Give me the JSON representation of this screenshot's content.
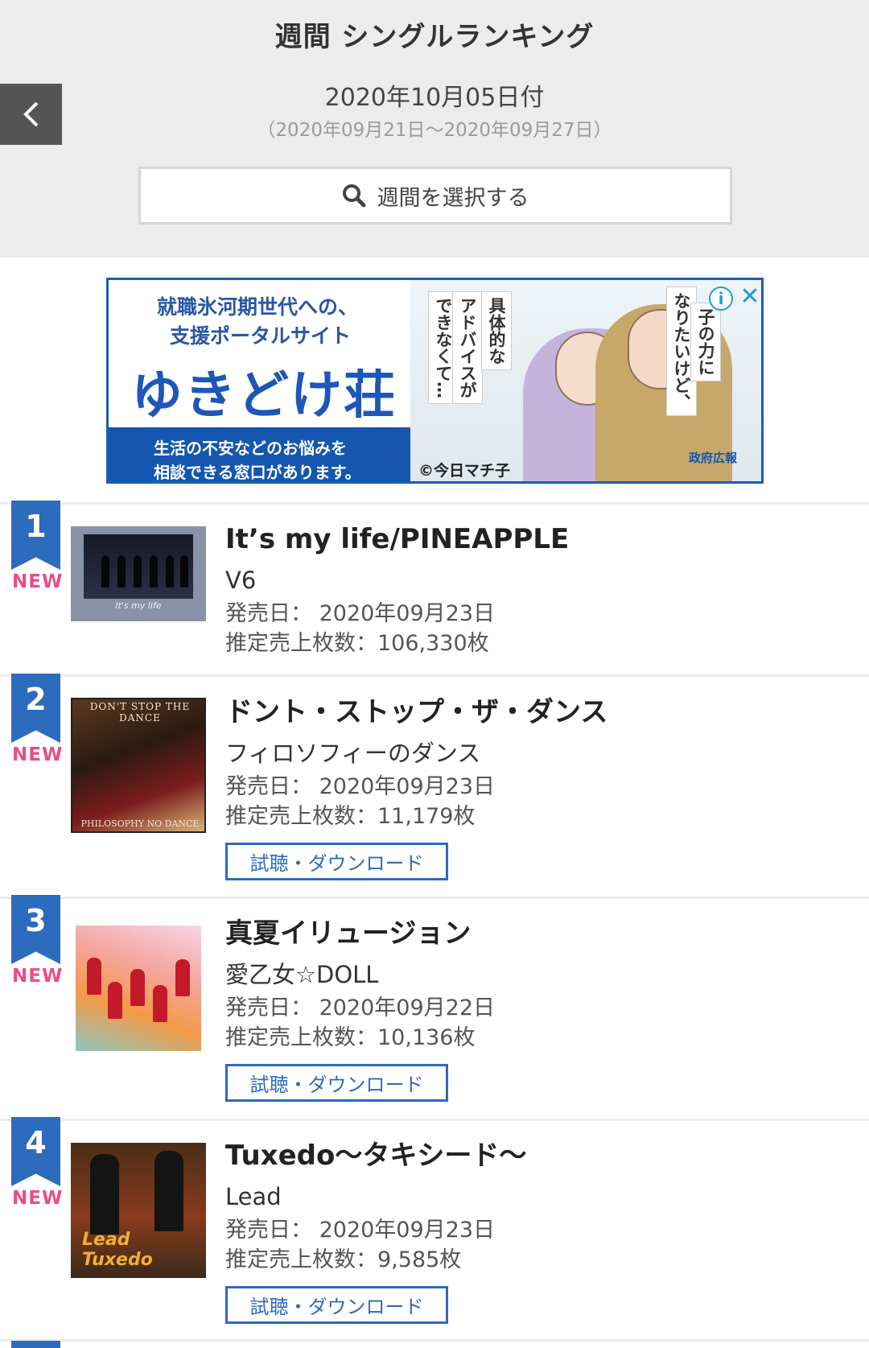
{
  "header": {
    "title": "週間 シングルランキング",
    "date": "2020年10月05日付",
    "range": "（2020年09月21日〜2020年09月27日）",
    "select_week_label": "週間を選択する"
  },
  "ad": {
    "line1": "就職氷河期世代への、",
    "line2": "支援ポータルサイト",
    "brand": "ゆきどけ荘",
    "bar_line1": "生活の不安などのお悩みを",
    "bar_line2": "相談できる窓口があります。",
    "bubble_a": "できなくて…",
    "bubble_b": "アドバイスが",
    "bubble_c": "具体的な",
    "bubble_d": "なりたいけど、",
    "bubble_e": "子の力に",
    "credit": "©今日マチ子",
    "logo_text": "政府広報",
    "info_label": "i",
    "close_label": "✕"
  },
  "rankings": [
    {
      "rank": "1",
      "badge": "NEW",
      "title": "It’s my life/PINEAPPLE",
      "artist": "V6",
      "release_date": "発売日： 2020年09月23日",
      "sales": "推定売上枚数：106,330枚",
      "jacket_caption": "It's my life"
    },
    {
      "rank": "2",
      "badge": "NEW",
      "title": "ドント・ストップ・ザ・ダンス",
      "artist": "フィロソフィーのダンス",
      "release_date": "発売日： 2020年09月23日",
      "sales": "推定売上枚数：11,179枚",
      "download_label": "試聴・ダウンロード",
      "jacket_top": "DON'T STOP THE DANCE",
      "jacket_bottom": "PHILOSOPHY NO DANCE"
    },
    {
      "rank": "3",
      "badge": "NEW",
      "title": "真夏イリュージョン",
      "artist": "愛乙女☆DOLL",
      "release_date": "発売日： 2020年09月22日",
      "sales": "推定売上枚数：10,136枚",
      "download_label": "試聴・ダウンロード"
    },
    {
      "rank": "4",
      "badge": "NEW",
      "title": "Tuxedo〜タキシード〜",
      "artist": "Lead",
      "release_date": "発売日： 2020年09月23日",
      "sales": "推定売上枚数：9,585枚",
      "download_label": "試聴・ダウンロード",
      "jacket_text": "Lead Tuxedo"
    }
  ],
  "colors": {
    "accent": "#2d6bbd",
    "new_badge": "#e94d88",
    "header_bg": "#ececec"
  }
}
